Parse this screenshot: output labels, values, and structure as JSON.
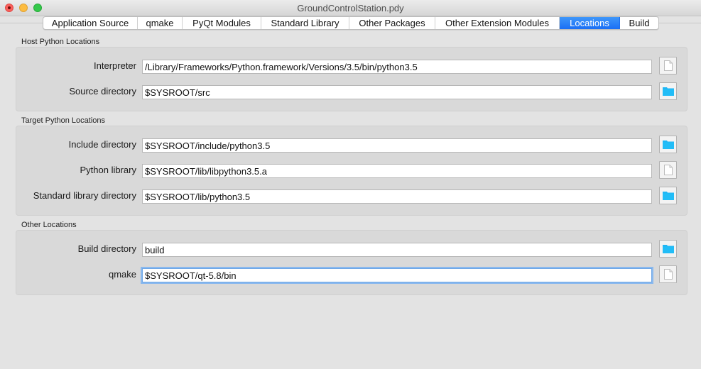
{
  "window": {
    "title": "GroundControlStation.pdy"
  },
  "tabs": [
    {
      "label": "Application Source",
      "active": false
    },
    {
      "label": "qmake",
      "active": false
    },
    {
      "label": "PyQt Modules",
      "active": false
    },
    {
      "label": "Standard Library",
      "active": false
    },
    {
      "label": "Other Packages",
      "active": false
    },
    {
      "label": "Other Extension Modules",
      "active": false
    },
    {
      "label": "Locations",
      "active": true
    },
    {
      "label": "Build",
      "active": false
    }
  ],
  "groups": {
    "host": {
      "title": "Host Python Locations",
      "rows": [
        {
          "label": "Interpreter",
          "value": "/Library/Frameworks/Python.framework/Versions/3.5/bin/python3.5",
          "button_icon": "file-icon"
        },
        {
          "label": "Source directory",
          "value": "$SYSROOT/src",
          "button_icon": "folder-icon"
        }
      ]
    },
    "target": {
      "title": "Target Python Locations",
      "rows": [
        {
          "label": "Include directory",
          "value": "$SYSROOT/include/python3.5",
          "button_icon": "folder-icon"
        },
        {
          "label": "Python library",
          "value": "$SYSROOT/lib/libpython3.5.a",
          "button_icon": "file-icon"
        },
        {
          "label": "Standard library directory",
          "value": "$SYSROOT/lib/python3.5",
          "button_icon": "folder-icon"
        }
      ]
    },
    "other": {
      "title": "Other Locations",
      "rows": [
        {
          "label": "Build directory",
          "value": "build",
          "button_icon": "folder-icon"
        },
        {
          "label": "qmake",
          "value": "$SYSROOT/qt-5.8/bin",
          "button_icon": "file-icon",
          "focused": true
        }
      ]
    }
  },
  "colors": {
    "accent": "#1a6ff5",
    "folder": "#1fb6f5",
    "focus_ring": "#8ab9ee"
  }
}
